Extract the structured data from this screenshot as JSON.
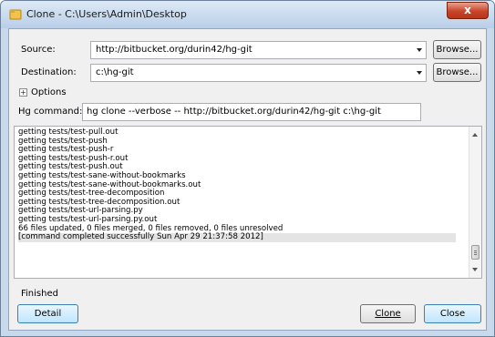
{
  "window": {
    "title": "Clone - C:\\Users\\Admin\\Desktop",
    "close_glyph": "x"
  },
  "form": {
    "source_label": "Source:",
    "source_value": "http://bitbucket.org/durin42/hg-git",
    "destination_label": "Destination:",
    "destination_value": "c:\\hg-git",
    "browse_label": "Browse...",
    "options_label": "Options",
    "options_expander": "+",
    "hg_command_label": "Hg command:",
    "hg_command_value": "hg clone --verbose -- http://bitbucket.org/durin42/hg-git c:\\hg-git"
  },
  "log": {
    "lines": [
      "getting tests/test-pull.out",
      "getting tests/test-push",
      "getting tests/test-push-r",
      "getting tests/test-push-r.out",
      "getting tests/test-push.out",
      "getting tests/test-sane-without-bookmarks",
      "getting tests/test-sane-without-bookmarks.out",
      "getting tests/test-tree-decomposition",
      "getting tests/test-tree-decomposition.out",
      "getting tests/test-url-parsing.py",
      "getting tests/test-url-parsing.py.out",
      "66 files updated, 0 files merged, 0 files removed, 0 files unresolved",
      "[command completed successfully Sun Apr 29 21:37:58 2012]"
    ],
    "highlighted_index": 12
  },
  "status": {
    "text": "Finished"
  },
  "buttons": {
    "detail": "Detail",
    "clone": "Clone",
    "close": "Close"
  },
  "colors": {
    "title_bar": "#c9d9ec",
    "close_button": "#c9452a",
    "focus_border": "#3c7fb1"
  }
}
